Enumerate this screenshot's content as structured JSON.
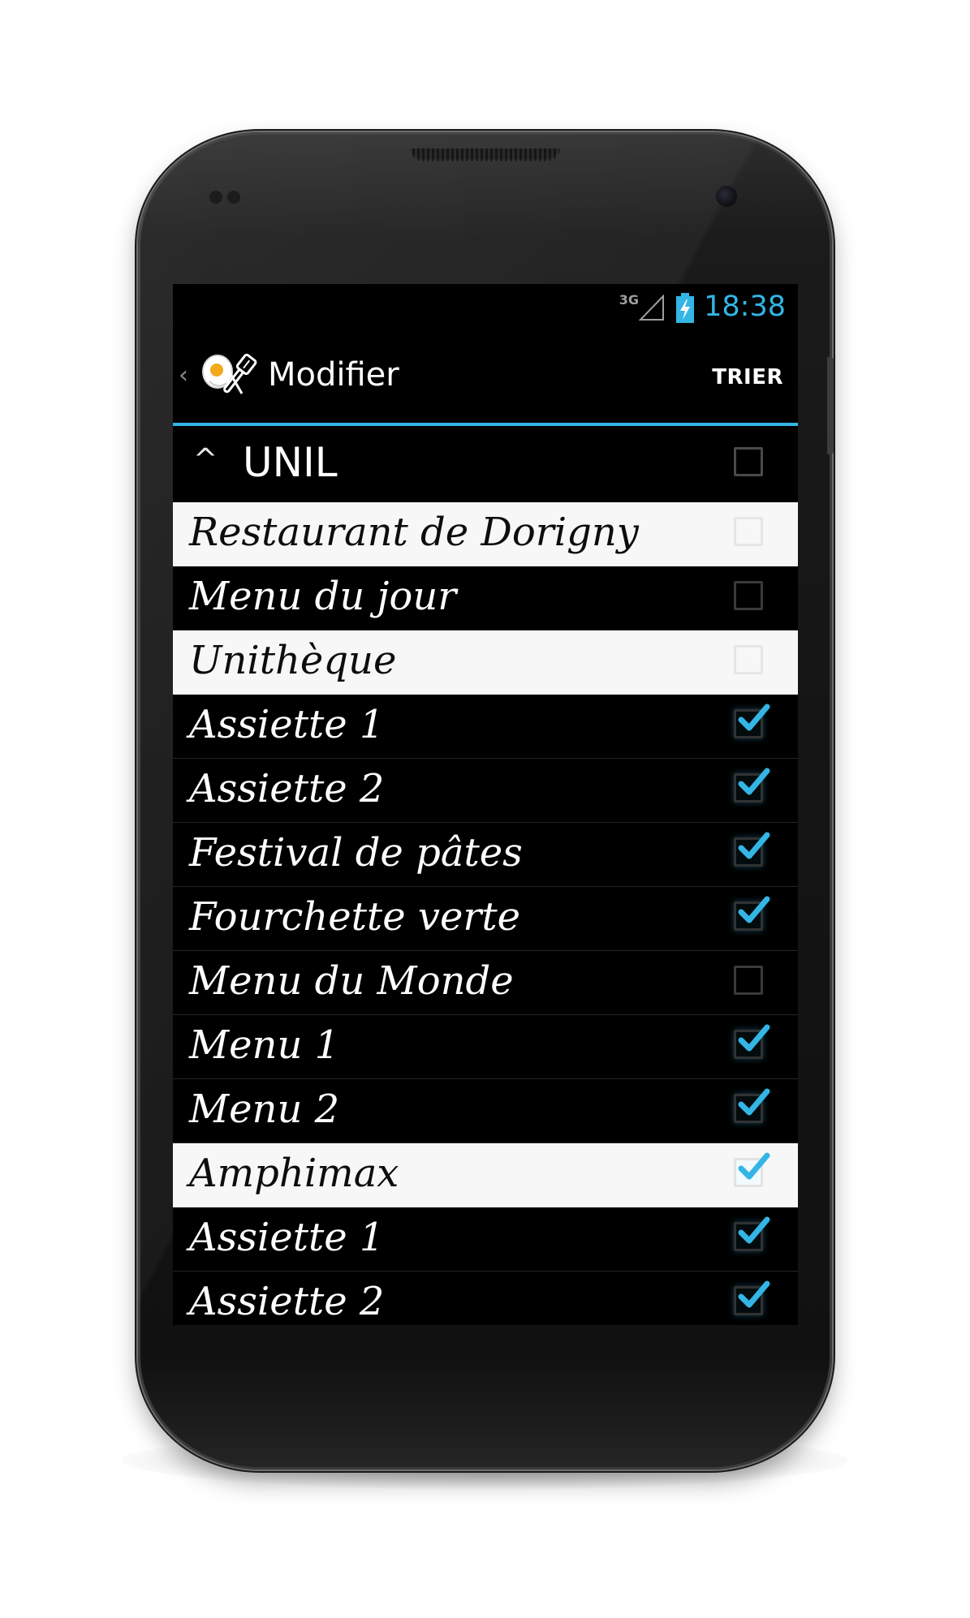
{
  "status_bar": {
    "network": "3G",
    "time": "18:38"
  },
  "action_bar": {
    "title": "Modifier",
    "sort_label": "TRIER"
  },
  "group": {
    "label": "UNIL",
    "checked": false
  },
  "rows": [
    {
      "label": "Restaurant de Dorigny",
      "style": "light",
      "checked": false
    },
    {
      "label": "Menu du jour",
      "style": "dark",
      "checked": false
    },
    {
      "label": "Unithèque",
      "style": "light",
      "checked": false
    },
    {
      "label": "Assiette 1",
      "style": "dark",
      "checked": true
    },
    {
      "label": "Assiette 2",
      "style": "dark",
      "checked": true
    },
    {
      "label": "Festival de pâtes",
      "style": "dark",
      "checked": true
    },
    {
      "label": "Fourchette verte",
      "style": "dark",
      "checked": true
    },
    {
      "label": "Menu du Monde",
      "style": "dark",
      "checked": false
    },
    {
      "label": "Menu 1",
      "style": "dark",
      "checked": true
    },
    {
      "label": "Menu 2",
      "style": "dark",
      "checked": true
    },
    {
      "label": "Amphimax",
      "style": "light",
      "checked": true
    },
    {
      "label": "Assiette 1",
      "style": "dark",
      "checked": true
    },
    {
      "label": "Assiette 2",
      "style": "dark",
      "checked": true
    }
  ],
  "colors": {
    "accent": "#33b5e5",
    "background": "#000000",
    "section_row": "#f7f7f7",
    "check": "#33b5e5"
  },
  "icons": {
    "up": "chevron-left-icon",
    "app": "fried-egg-and-spatula-icon",
    "collapse": "chevron-up-icon",
    "signal": "signal-strength-icon",
    "battery": "battery-charging-icon"
  }
}
